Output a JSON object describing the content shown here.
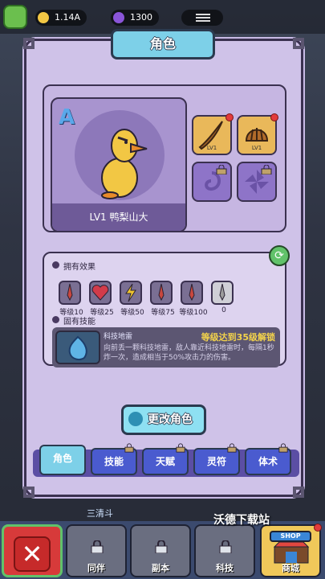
{
  "topbar": {
    "coins": "1.14A",
    "gems": "1300",
    "side_text": "..."
  },
  "panel": {
    "title": "角色"
  },
  "character": {
    "rank": "A",
    "level_name": "LV1  鸭梨山大",
    "slots": [
      {
        "lv": "LV1",
        "icon": "feather-icon",
        "badge": "0"
      },
      {
        "lv": "LV1",
        "icon": "shell-icon",
        "badge": "0"
      },
      {
        "icon": "spiral-icon",
        "locked": true
      },
      {
        "icon": "pinwheel-icon",
        "locked": true
      }
    ]
  },
  "effects": {
    "header": "拥有效果",
    "items": [
      {
        "caption": "等级10",
        "icon": "sword-icon",
        "color": "#c8473f"
      },
      {
        "caption": "等级25",
        "icon": "heart-icon",
        "color": "#d23b4a"
      },
      {
        "caption": "等级50",
        "icon": "lightning-icon",
        "color": "#f0c52e"
      },
      {
        "caption": "等级75",
        "icon": "sword-icon",
        "color": "#c8473f"
      },
      {
        "caption": "等级100",
        "icon": "sword-icon",
        "color": "#c8473f"
      },
      {
        "caption": "0",
        "icon": "grey-sword-icon",
        "color": "#9c9c9c"
      }
    ],
    "skill_header": "固有技能",
    "skill_name": "科技地雷",
    "skill_req": "等级达到35级解锁",
    "skill_desc": "向前丢一颗科技地雷，敌人靠近科技地雷时，每隔1秒炸一次，造成相当于50%攻击力的伤害。"
  },
  "change_button": "更改角色",
  "tabs": [
    {
      "label": "角色",
      "active": true
    },
    {
      "label": "技能",
      "locked": true
    },
    {
      "label": "天赋",
      "locked": true
    },
    {
      "label": "灵符",
      "locked": true
    },
    {
      "label": "体术",
      "locked": true
    }
  ],
  "bottomnav": [
    {
      "label": "同伴",
      "locked": true
    },
    {
      "label": "副本",
      "locked": true
    },
    {
      "label": "科技",
      "locked": true
    },
    {
      "label": "商城",
      "sign": "SHOP"
    }
  ],
  "overlay": {
    "watermark": "沃德下载站",
    "under_text": "三清斗"
  },
  "colors": {
    "panel": "#cfc2e8",
    "accent": "#7dd0e8",
    "tab": "#4a5bcf",
    "gold_text": "#f2d24b"
  }
}
